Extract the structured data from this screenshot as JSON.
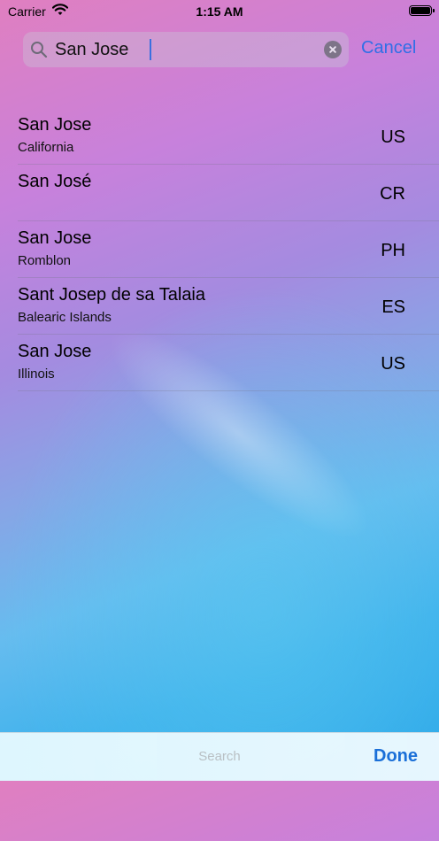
{
  "status_bar": {
    "carrier": "Carrier",
    "time": "1:15 AM"
  },
  "search": {
    "value": "San Jose",
    "cancel_label": "Cancel"
  },
  "results": [
    {
      "city": "San Jose",
      "region": "California",
      "country": "US"
    },
    {
      "city": "San José",
      "region": "",
      "country": "CR"
    },
    {
      "city": "San Jose",
      "region": "Romblon",
      "country": "PH"
    },
    {
      "city": "Sant Josep de sa Talaia",
      "region": "Balearic Islands",
      "country": "ES"
    },
    {
      "city": "San Jose",
      "region": "Illinois",
      "country": "US"
    }
  ],
  "toolbar": {
    "search_label": "Search",
    "done_label": "Done"
  },
  "colors": {
    "accent": "#2f6fe6",
    "done": "#1a6fd8"
  }
}
